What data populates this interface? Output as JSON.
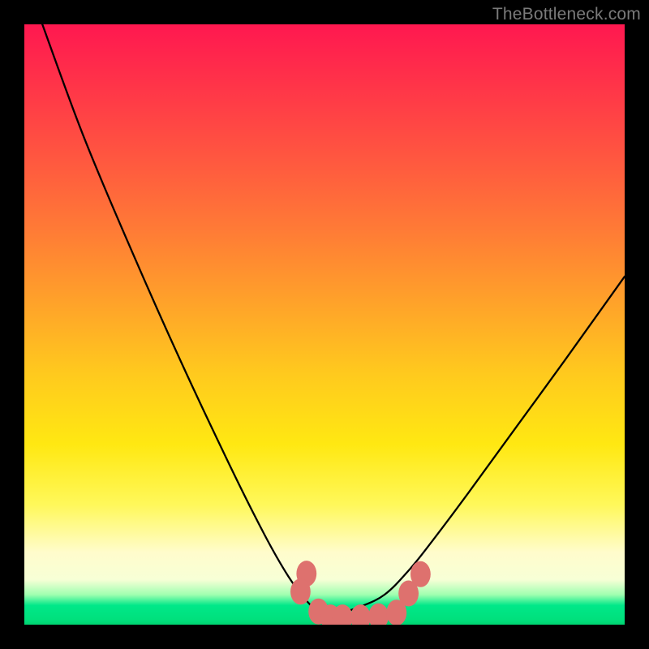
{
  "watermark": "TheBottleneck.com",
  "chart_data": {
    "type": "line",
    "title": "",
    "xlabel": "",
    "ylabel": "",
    "xlim": [
      0,
      100
    ],
    "ylim": [
      0,
      100
    ],
    "grid": false,
    "background": "red-yellow-green vertical gradient",
    "series": [
      {
        "name": "bottleneck-curve",
        "x": [
          3,
          10,
          18,
          26,
          34,
          40,
          44,
          47,
          49,
          50,
          51,
          53,
          56,
          60,
          64,
          68,
          74,
          82,
          90,
          100
        ],
        "y": [
          100,
          81,
          62,
          44,
          27,
          15,
          8,
          4,
          2,
          1,
          1,
          2,
          3,
          5,
          9,
          14,
          22,
          33,
          44,
          58
        ]
      }
    ],
    "markers": [
      {
        "name": "marker",
        "x": 47,
        "y": 8.5,
        "color": "#de716e",
        "r": 1.6
      },
      {
        "name": "marker",
        "x": 46,
        "y": 5.5,
        "color": "#de716e",
        "r": 1.6
      },
      {
        "name": "marker",
        "x": 49,
        "y": 2.2,
        "color": "#de716e",
        "r": 1.6
      },
      {
        "name": "marker",
        "x": 51,
        "y": 1.2,
        "color": "#de716e",
        "r": 1.6
      },
      {
        "name": "marker",
        "x": 53,
        "y": 1.2,
        "color": "#de716e",
        "r": 1.6
      },
      {
        "name": "marker",
        "x": 56,
        "y": 1.2,
        "color": "#de716e",
        "r": 1.6
      },
      {
        "name": "marker",
        "x": 59,
        "y": 1.4,
        "color": "#de716e",
        "r": 1.6
      },
      {
        "name": "marker",
        "x": 62,
        "y": 2.0,
        "color": "#de716e",
        "r": 1.6
      },
      {
        "name": "marker",
        "x": 64,
        "y": 5.2,
        "color": "#de716e",
        "r": 1.6
      },
      {
        "name": "marker",
        "x": 66,
        "y": 8.4,
        "color": "#de716e",
        "r": 1.6
      }
    ]
  }
}
